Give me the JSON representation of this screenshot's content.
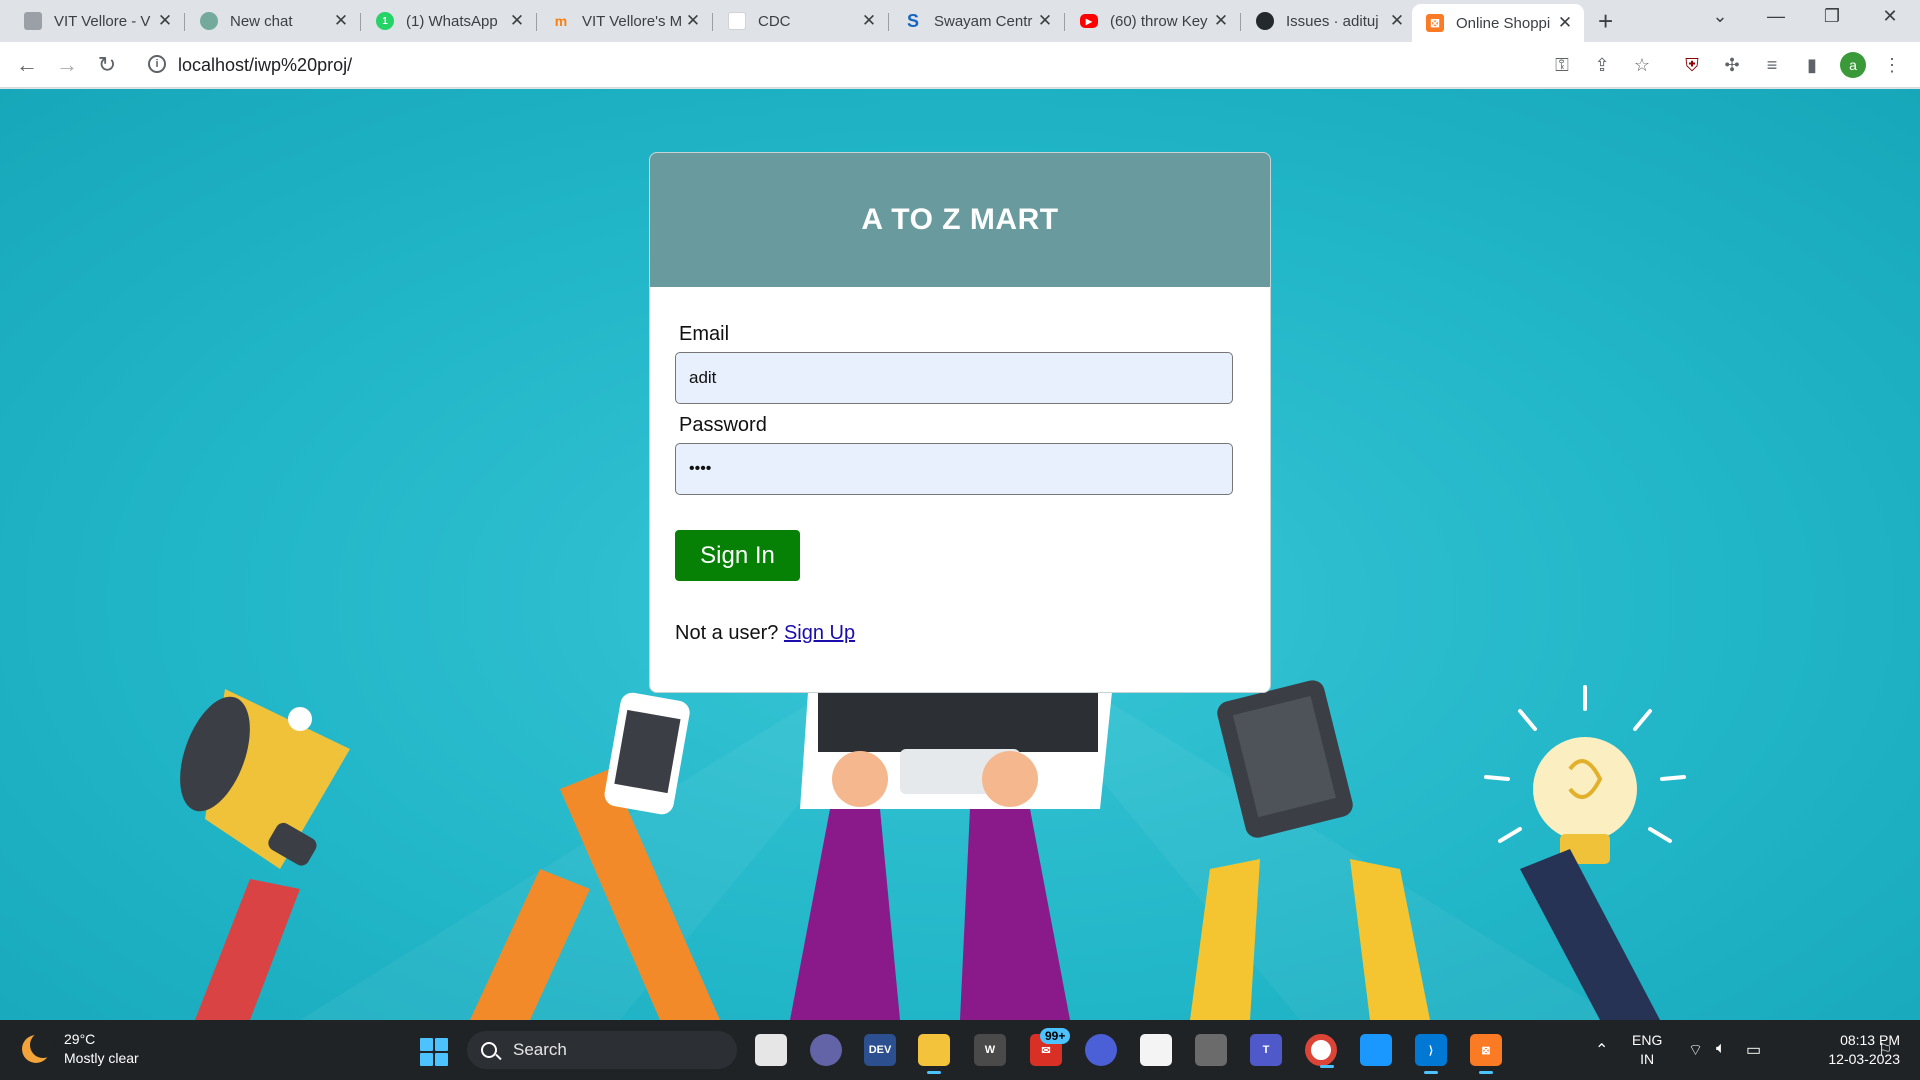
{
  "browser": {
    "tabs": [
      {
        "title": "VIT Vellore - V",
        "icon": "vit-icon",
        "color": "#9aa0a6"
      },
      {
        "title": "New chat",
        "icon": "chatgpt-icon",
        "color": "#74aa9c"
      },
      {
        "title": "(1) WhatsApp",
        "icon": "whatsapp-icon",
        "color": "#25d366"
      },
      {
        "title": "VIT Vellore's M",
        "icon": "moodle-icon",
        "color": "#f98012"
      },
      {
        "title": "CDC",
        "icon": "cdc-icon",
        "color": "#cfd3d6"
      },
      {
        "title": "Swayam Centr",
        "icon": "swayam-icon",
        "color": "#1565c0"
      },
      {
        "title": "(60) throw Key",
        "icon": "youtube-icon",
        "color": "#ff0000"
      },
      {
        "title": "Issues · adituj",
        "icon": "github-icon",
        "color": "#24292e"
      },
      {
        "title": "Online Shoppi",
        "icon": "xampp-icon",
        "color": "#fb7a24"
      }
    ],
    "active_tab_index": 8,
    "url": "localhost/iwp%20proj/",
    "profile_initial": "a"
  },
  "login": {
    "title": "A TO Z MART",
    "email_label": "Email",
    "email_value": "adit",
    "password_label": "Password",
    "password_value": "••••",
    "signin_label": "Sign In",
    "not_user_text": "Not a user?",
    "signup_link": "Sign Up"
  },
  "colors": {
    "header_bg": "#689a9e",
    "signin_bg": "#078006",
    "page_bg": "#21b6c8"
  },
  "taskbar": {
    "weather_temp": "29°C",
    "weather_desc": "Mostly clear",
    "search_label": "Search",
    "mail_badge": "99+",
    "lang_line1": "ENG",
    "lang_line2": "IN",
    "time": "08:13 PM",
    "date": "12-03-2023"
  }
}
